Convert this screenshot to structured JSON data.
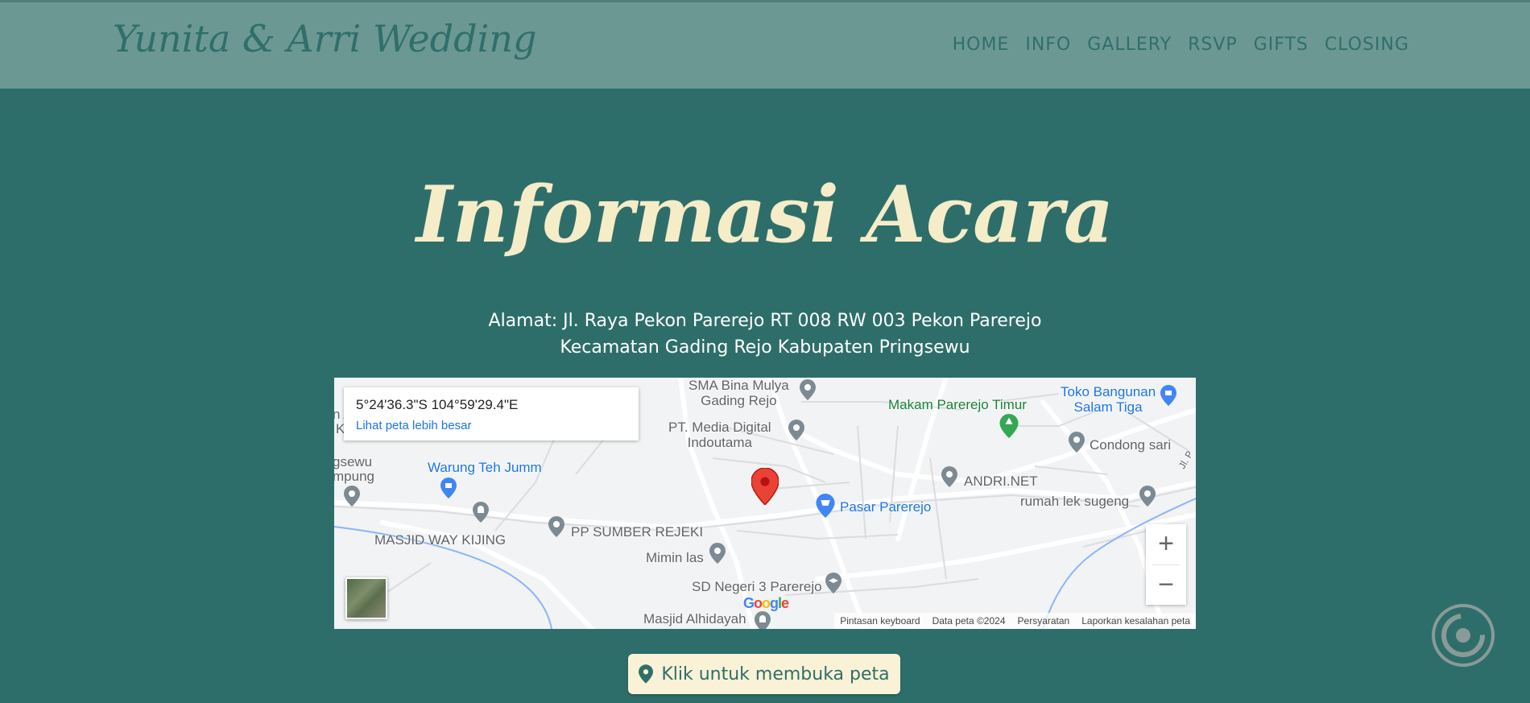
{
  "nav": {
    "brand": "Yunita & Arri Wedding",
    "items": [
      "HOME",
      "INFO",
      "GALLERY",
      "RSVP",
      "GIFTS",
      "CLOSING"
    ]
  },
  "section": {
    "title": "Informasi Acara",
    "address_line1": "Alamat: Jl. Raya Pekon Parerejo RT 008 RW 003 Pekon Parerejo",
    "address_line2": "Kecamatan Gading Rejo Kabupaten Pringsewu"
  },
  "map": {
    "coords": "5°24'36.3\"S 104°59'29.4\"E",
    "larger_map_link": "Lihat peta lebih besar",
    "places": {
      "sma": "SMA Bina Mulya\nGading Rejo",
      "pt_media": "PT. Media Digital\nIndoutama",
      "makam": "Makam Parerejo Timur",
      "toko": "Toko Bangunan\nSalam Tiga",
      "condong": "Condong sari",
      "warung": "Warung Teh Jumm",
      "andri": "ANDRI.NET",
      "pasar": "Pasar Parerejo",
      "rumah": "rumah lek sugeng",
      "masjid_way": "MASJID WAY KIJING",
      "pp_sumber": "PP SUMBER REJEKI",
      "mimin": "Mimin las",
      "sd": "SD Negeri 3 Parerejo",
      "masjid_alhidayah": "Masjid Alhidayah",
      "left_edge_1": "n A",
      "left_edge_2": "K",
      "left_edge_3": "gsewu",
      "left_edge_4": "mpung",
      "jl": "Jl. P"
    },
    "zoom_in": "+",
    "zoom_out": "−",
    "logo": "Google",
    "attribution": [
      "Pintasan keyboard",
      "Data peta ©2024",
      "Persyaratan",
      "Laporkan kesalahan peta"
    ]
  },
  "open_map_button": "Klik untuk membuka peta",
  "colors": {
    "background": "#2e6e6a",
    "navbar": "#6c9894",
    "title": "#f5ecc8",
    "button_bg": "#f9f2d6",
    "pin_red": "#ea4335"
  }
}
